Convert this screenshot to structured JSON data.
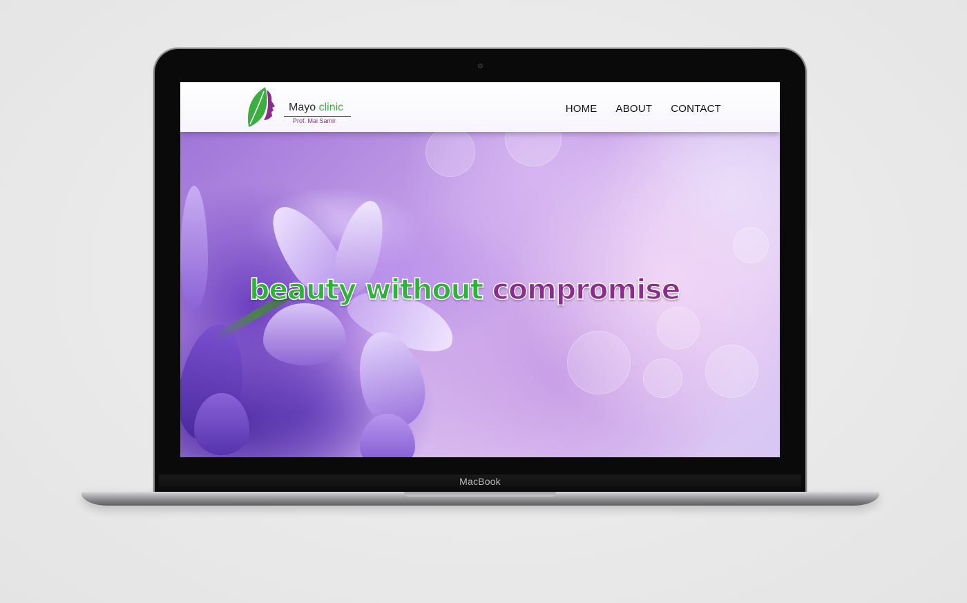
{
  "device": {
    "brand_label": "MacBook"
  },
  "site": {
    "logo": {
      "title_primary": "Mayo",
      "title_accent": "clinic",
      "subtitle": "Prof. Mai Samir",
      "icon": "leaf-face-logo-icon"
    },
    "nav": {
      "items": [
        {
          "label": "HOME"
        },
        {
          "label": "ABOUT"
        },
        {
          "label": "CONTACT"
        }
      ]
    },
    "hero": {
      "headline_green": "beauty without",
      "headline_purple": "compromise",
      "background": "purple-flowers-image"
    }
  },
  "colors": {
    "accent_green": "#2eb33a",
    "accent_purple": "#8d2b8f",
    "navbar_bg": "#ffffff",
    "device_frame": "#0a0a0a"
  }
}
